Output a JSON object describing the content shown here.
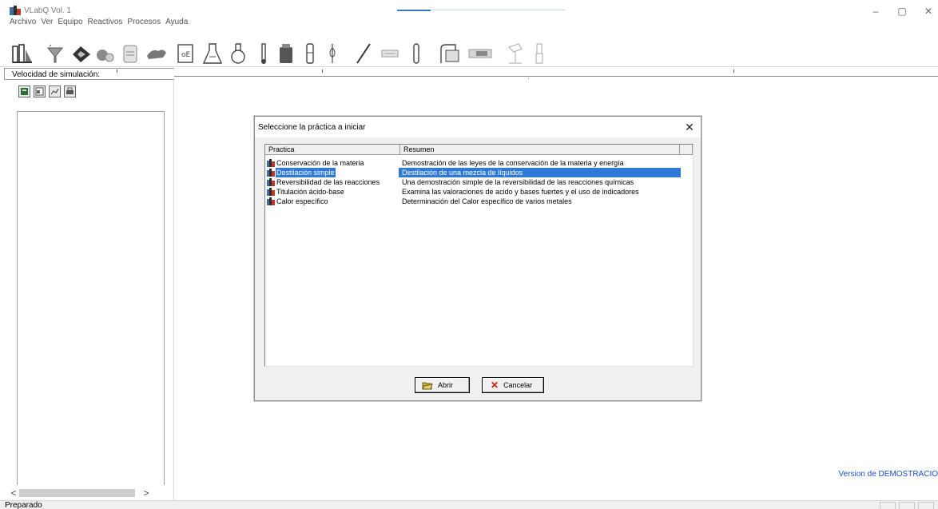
{
  "window": {
    "title": "VLabQ Vol. 1",
    "app_icon": "flask-icon",
    "minimize_glyph": "–",
    "maximize_glyph": "▢",
    "close_glyph": "✕"
  },
  "menubar": [
    "Archivo",
    "Ver",
    "Equipo",
    "Reactivos",
    "Procesos",
    "Ayuda"
  ],
  "toolbar": {
    "tools": [
      "lab-icon",
      "funnel-icon",
      "rack-icon",
      "burner-icon",
      "beaker-icon",
      "balance-icon",
      "graduated-beaker-icon",
      "erlenmeyer-flask-icon",
      "round-flask-icon",
      "thermometer-icon",
      "bottle-icon",
      "cylinder-icon",
      "pipette-icon",
      "rod-icon",
      "battery-icon",
      "test-tube-icon",
      "meter-icon",
      "display-icon",
      "stand-icon",
      "burette-icon"
    ]
  },
  "speed": {
    "label": "Velocidad de simulación:"
  },
  "left_panel": {
    "icons": [
      "calculator-icon",
      "properties-icon",
      "chart-icon",
      "print-icon"
    ],
    "scroll_left": "<",
    "scroll_right": ">"
  },
  "main": {
    "version_text": "Version de DEMOSTRACIO"
  },
  "status": {
    "text": "Preparado"
  },
  "dialog": {
    "title": "Seleccione la práctica a iniciar",
    "close_glyph": "✕",
    "columns": [
      "Practica",
      "Resumen"
    ],
    "rows": [
      {
        "practice": "Conservación de la materia",
        "summary": "Demostración de las leyes de la conservación de la materia y energía",
        "selected": false
      },
      {
        "practice": "Destilación simple",
        "summary": "Destilación de una mezcla de líquidos",
        "selected": true
      },
      {
        "practice": "Reversibilidad de las reacciones",
        "summary": "Una demostración simple de la reversibilidad de las reacciones  químicas",
        "selected": false
      },
      {
        "practice": "Titulación ácido-base",
        "summary": "Examina las valoraciones de acido y bases fuertes y el uso de indicadores",
        "selected": false
      },
      {
        "practice": "Calor específico",
        "summary": "Determinación del Calor específico de varios metales",
        "selected": false
      }
    ],
    "ok_label": "Abrir",
    "cancel_label": "Cancelar"
  }
}
